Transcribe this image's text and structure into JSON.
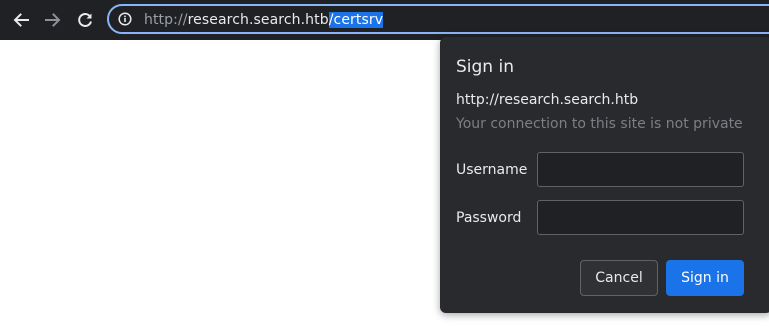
{
  "toolbar": {
    "back_icon": "back-arrow-icon",
    "forward_icon": "forward-arrow-icon",
    "reload_icon": "reload-icon"
  },
  "omnibox": {
    "info_icon": "info-icon",
    "url_scheme": "http://",
    "url_host": "research.search.htb",
    "url_path": "/certsrv",
    "focus_color": "#8ab4f8",
    "selection_color": "#1a73e8"
  },
  "dialog": {
    "title": "Sign in",
    "origin": "http://research.search.htb",
    "warning": "Your connection to this site is not private",
    "username_label": "Username",
    "username_value": "",
    "password_label": "Password",
    "password_value": "",
    "cancel_label": "Cancel",
    "signin_label": "Sign in",
    "primary_color": "#1a73e8"
  }
}
